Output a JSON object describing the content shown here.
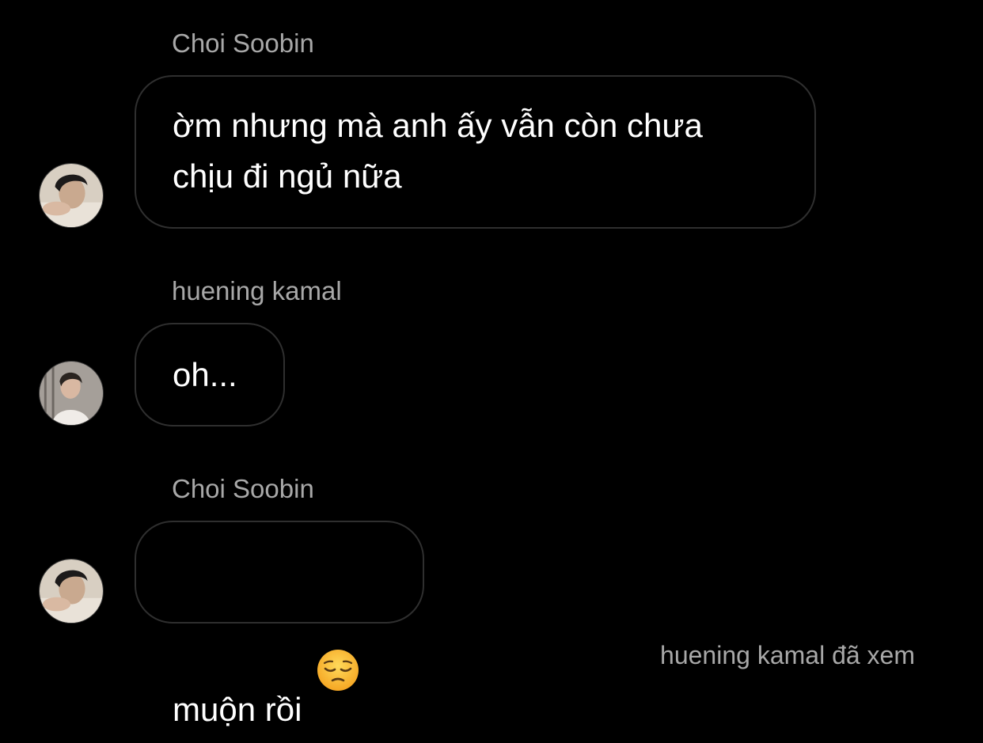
{
  "messages": [
    {
      "sender": "Choi Soobin",
      "text": "ờm nhưng mà anh ấy vẫn còn chưa\nchịu đi ngủ nữa",
      "avatar_icon": "user-avatar-soobin"
    },
    {
      "sender": "huening kamal",
      "text": "oh...",
      "avatar_icon": "user-avatar-kamal"
    },
    {
      "sender": "Choi Soobin",
      "text": "muộn rồi",
      "emoji": "pensive-face-emoji",
      "avatar_icon": "user-avatar-soobin"
    }
  ],
  "status": {
    "seen_text": "huening kamal đã xem"
  },
  "colors": {
    "background": "#000000",
    "bubble_border": "#2f2f2f",
    "name_text": "#a8a8a8",
    "message_text": "#ffffff"
  }
}
